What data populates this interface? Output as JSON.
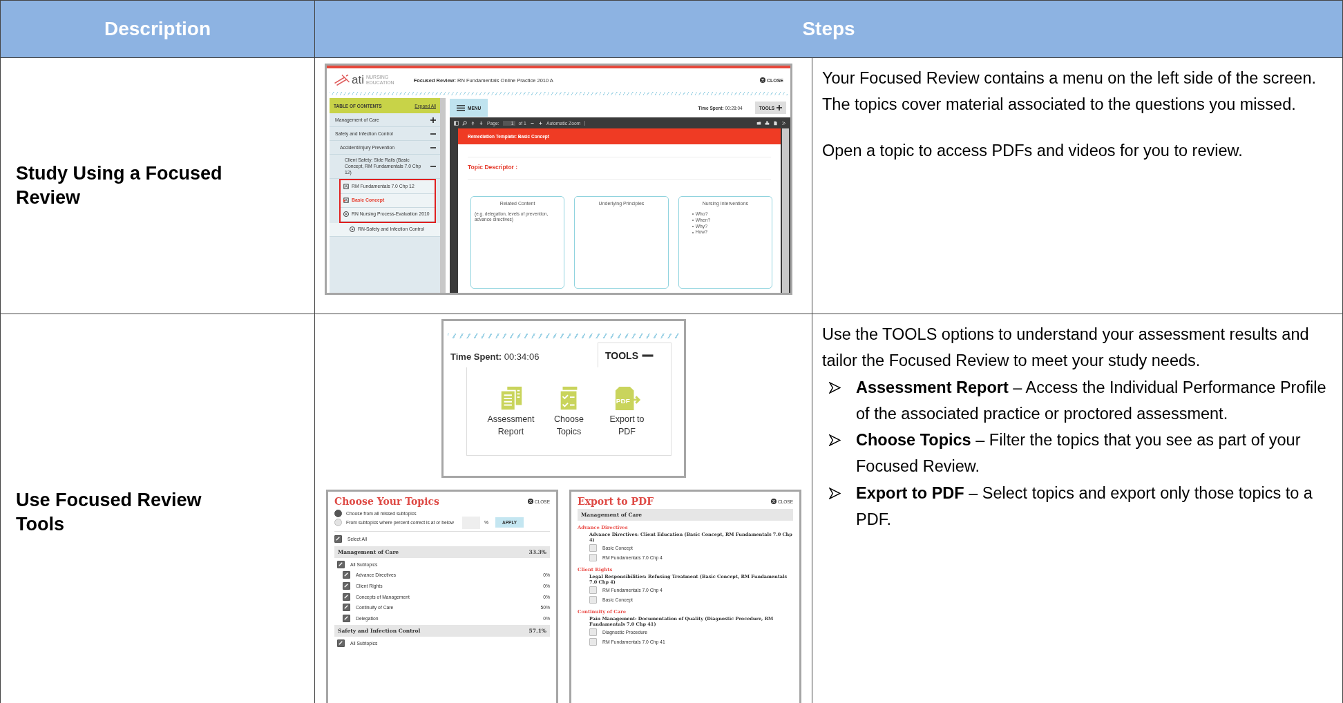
{
  "table": {
    "columns": [
      {
        "label": "Description"
      },
      {
        "label": "Steps"
      }
    ]
  },
  "rows": [
    {
      "description": "Study Using a Focused Review",
      "screenshot": {
        "logo": {
          "mark": "ati",
          "tagline": [
            "NURSING",
            "EDUCATION"
          ]
        },
        "title_label": "Focused Review:",
        "title": "RN Fundamentals Online Practice 2010 A",
        "close": "CLOSE",
        "toc": {
          "title": "TABLE OF CONTENTS",
          "expand_all": "Expand All",
          "items": [
            {
              "label": "Management of Care",
              "expanded": false
            },
            {
              "label": "Safety and Infection Control",
              "expanded": true,
              "children": [
                {
                  "label": "Accident/Injury Prevention",
                  "expanded": true,
                  "children": [
                    {
                      "label": "Client Safety: Side Rails (Basic Concept, RM Fundamentals 7.0 Chp 12)",
                      "expanded": true,
                      "children": [
                        {
                          "label": "RM Fundamentals 7.0 Chp 12",
                          "kind": "pdf",
                          "selected": false,
                          "highlighted": true
                        },
                        {
                          "label": "Basic Concept",
                          "kind": "pdf",
                          "selected": true,
                          "highlighted": true
                        },
                        {
                          "label": "RN Nursing Process-Evaluation 2010",
                          "kind": "video",
                          "selected": false,
                          "highlighted": true
                        },
                        {
                          "label": "RN-Safety and Infection Control",
                          "kind": "video",
                          "selected": false,
                          "highlighted": false
                        }
                      ]
                    }
                  ]
                }
              ]
            }
          ]
        },
        "menu": "MENU",
        "time_label": "Time Spent:",
        "time": "00:28:04",
        "tools": {
          "label": "TOOLS",
          "expanded": false
        },
        "viewer": {
          "page_label": "Page:",
          "page": "1",
          "page_count": "of 1",
          "zoom": "Automatic Zoom",
          "banner": "Remediation Template: Basic Concept",
          "heading": "Topic Descriptor :",
          "cards": [
            {
              "title": "Related Content",
              "note": "(e.g. delegation, levels of prevention, advance directives)"
            },
            {
              "title": "Underlying Principles"
            },
            {
              "title": "Nursing Interventions",
              "bullets": [
                "Who?",
                "When?",
                "Why?",
                "How?"
              ]
            }
          ]
        }
      },
      "paragraphs": [
        "Your Focused Review contains a menu on the left side of the screen. The topics cover material associated to the questions you missed.",
        "Open a topic to access PDFs and videos for you to review."
      ]
    },
    {
      "description": "Use Focused Review Tools",
      "tools_panel": {
        "time_label": "Time Spent:",
        "time": "00:34:06",
        "tools": {
          "label": "TOOLS",
          "expanded": true
        },
        "options": [
          {
            "label": "Assessment Report",
            "kind": "report"
          },
          {
            "label": "Choose Topics",
            "kind": "checklist"
          },
          {
            "label": "Export to PDF",
            "kind": "export",
            "icon_text": "PDF"
          }
        ]
      },
      "choose_topics": {
        "title": "Choose Your Topics",
        "close": "CLOSE",
        "radios": [
          {
            "label": "Choose from all missed subtopics",
            "selected": true
          },
          {
            "label": "From subtopics where percent correct is at or below",
            "selected": false
          }
        ],
        "unit": "%",
        "apply": "APPLY",
        "select_all": {
          "label": "Select All",
          "checked": true
        },
        "groups": [
          {
            "name": "Management of Care",
            "score": "33.3%",
            "all": {
              "label": "All Subtopics",
              "checked": true
            },
            "subtopics": [
              {
                "label": "Advance Directives",
                "score": "0%",
                "checked": true
              },
              {
                "label": "Client Rights",
                "score": "0%",
                "checked": true
              },
              {
                "label": "Concepts of Management",
                "score": "0%",
                "checked": true
              },
              {
                "label": "Continuity of Care",
                "score": "50%",
                "checked": true
              },
              {
                "label": "Delegation",
                "score": "0%",
                "checked": true
              }
            ]
          },
          {
            "name": "Safety and Infection Control",
            "score": "57.1%",
            "all": {
              "label": "All Subtopics",
              "checked": true
            }
          }
        ]
      },
      "export_pdf": {
        "title": "Export to PDF",
        "close": "CLOSE",
        "section": "Management of Care",
        "topics": [
          {
            "name": "Advance Directives",
            "heading": "Advance Directives: Client Education (Basic Concept, RM Fundamentals 7.0 Chp 4)",
            "options": [
              {
                "label": "Basic Concept",
                "checked": false
              },
              {
                "label": "RM Fundamentals 7.0 Chp 4",
                "checked": false
              }
            ]
          },
          {
            "name": "Client Rights",
            "heading": "Legal Responsibilities: Refusing Treatment (Basic Concept, RM Fundamentals 7.0 Chp 4)",
            "options": [
              {
                "label": "RM Fundamentals 7.0 Chp 4",
                "checked": false
              },
              {
                "label": "Basic Concept",
                "checked": false
              }
            ]
          },
          {
            "name": "Continuity of Care",
            "heading": "Pain Management: Documentation of Quality (Diagnostic Procedure, RM Fundamentals 7.0 Chp 41)",
            "options": [
              {
                "label": "Diagnostic Procedure",
                "checked": false
              },
              {
                "label": "RM Fundamentals 7.0 Chp 41",
                "checked": false
              }
            ]
          }
        ]
      },
      "intro": "Use the TOOLS options to understand your assessment results and tailor the Focused Review to meet your study needs.",
      "bullets": [
        "**Assessment Report** – Access the Individual Performance Profile of the associated practice or proctored assessment.",
        "**Choose Topics** – Filter the topics that you see as part of your Focused Review.",
        "**Export to PDF** – Select topics and export only those topics to a PDF."
      ]
    }
  ]
}
